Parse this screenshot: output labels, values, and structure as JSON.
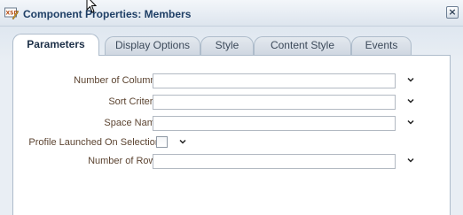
{
  "dialog": {
    "title": "Component Properties: Members",
    "app_icon": "xsd-edit-icon",
    "close_icon": "close-icon",
    "close_glyph": "×"
  },
  "tabs": [
    {
      "label": "Parameters",
      "active": true
    },
    {
      "label": "Display Options",
      "active": false
    },
    {
      "label": "Style",
      "active": false
    },
    {
      "label": "Content Style",
      "active": false
    },
    {
      "label": "Events",
      "active": false
    }
  ],
  "fields": [
    {
      "label": "Number of Columns",
      "type": "text",
      "value": ""
    },
    {
      "label": "Sort Criteria",
      "type": "text",
      "value": ""
    },
    {
      "label": "Space Name",
      "type": "text",
      "value": ""
    },
    {
      "label": "Profile Launched On Selection",
      "type": "checkbox",
      "checked": false
    },
    {
      "label": "Number of Rows",
      "type": "text",
      "value": ""
    }
  ],
  "colors": {
    "title": "#1f3f66",
    "label": "#5c4431",
    "panel_border": "#aebccb"
  }
}
